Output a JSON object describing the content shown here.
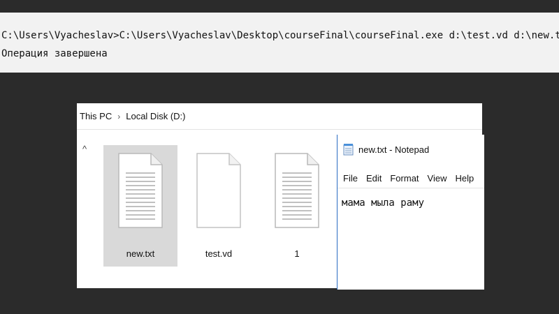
{
  "console": {
    "line1": "C:\\Users\\Vyacheslav>C:\\Users\\Vyacheslav\\Desktop\\courseFinal\\courseFinal.exe d:\\test.vd d:\\new.txt d",
    "line2": "Операция завершена"
  },
  "explorer": {
    "breadcrumb": [
      "This PC",
      "Local Disk (D:)"
    ],
    "breadcrumb_separator": "›",
    "files": [
      {
        "name": "new.txt",
        "selected": true,
        "icon": "text-file-icon"
      },
      {
        "name": "test.vd",
        "selected": false,
        "icon": "blank-file-icon"
      },
      {
        "name": "1",
        "selected": false,
        "icon": "text-file-icon"
      }
    ]
  },
  "notepad": {
    "title": "new.txt - Notepad",
    "menu": [
      "File",
      "Edit",
      "Format",
      "View",
      "Help"
    ],
    "content": "мама мыла раму"
  },
  "colors": {
    "background": "#2b2b2b",
    "console_bg": "#f2f2f2",
    "selection": "#d9d9d9",
    "notepad_border": "#2a6cc2"
  }
}
